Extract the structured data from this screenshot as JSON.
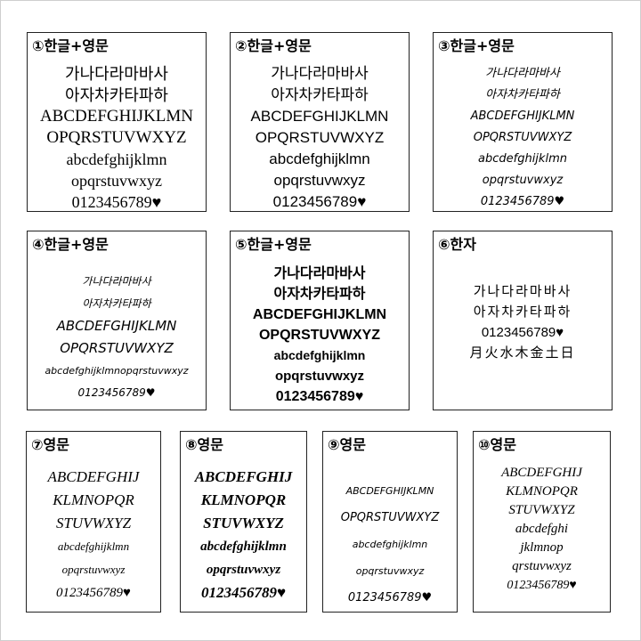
{
  "samples": [
    {
      "title": "①한글+영문",
      "lines": [
        "가나다라마바사",
        "아자차카타파하",
        "ABCDEFGHIJKLMN",
        "OPQRSTUVWXYZ",
        "abcdefghijklmn",
        "opqrstuvwxyz",
        "0123456789♥"
      ]
    },
    {
      "title": "②한글+영문",
      "lines": [
        "가나다라마바사",
        "아자차카타파하",
        "ABCDEFGHIJKLMN",
        "OPQRSTUVWXYZ",
        "abcdefghijklmn",
        "opqrstuvwxyz",
        "0123456789♥"
      ]
    },
    {
      "title": "③한글+영문",
      "lines": [
        "가나다라마바사",
        "아자차카타파하",
        "ABCDEFGHIJKLMN",
        "OPQRSTUVWXYZ",
        "abcdefghijklmn",
        "opqrstuvwxyz",
        "0123456789♥"
      ]
    },
    {
      "title": "④한글+영문",
      "lines": [
        "가나다라마바사",
        "아자차카타파하",
        "ABCDEFGHIJKLMN",
        "OPQRSTUVWXYZ",
        "abcdefghijklmnopqrstuvwxyz",
        "0123456789♥"
      ]
    },
    {
      "title": "⑤한글+영문",
      "lines": [
        "가나다라마바사",
        "아자차카타파하",
        "ABCDEFGHIJKLMN",
        "OPQRSTUVWXYZ",
        "abcdefghijklmn",
        "opqrstuvwxyz",
        "0123456789♥"
      ]
    },
    {
      "title": "⑥한자",
      "lines": [
        "가나다라마바사",
        "아자차카타파하",
        "0123456789♥",
        "月火水木金土日"
      ]
    },
    {
      "title": "⑦영문",
      "lines": [
        "ABCDEFGHIJ",
        "KLMNOPQR",
        "STUVWXYZ",
        "abcdefghijklmn",
        "opqrstuvwxyz",
        "0123456789♥"
      ]
    },
    {
      "title": "⑧영문",
      "lines": [
        "ABCDEFGHIJ",
        "KLMNOPQR",
        "STUVWXYZ",
        "abcdefghijklmn",
        "opqrstuvwxyz",
        "0123456789♥"
      ]
    },
    {
      "title": "⑨영문",
      "lines": [
        "ABCDEFGHIJKLMN",
        "OPQRSTUVWXYZ",
        "abcdefghijklmn",
        "opqrstuvwxyz",
        "0123456789♥"
      ]
    },
    {
      "title": "⑩영문",
      "lines": [
        "ABCDEFGHIJ",
        "KLMNOPQR",
        "STUVWXYZ",
        "abcdefghi",
        "jklmnop",
        "qrstuvwxyz",
        "0123456789♥"
      ]
    }
  ]
}
